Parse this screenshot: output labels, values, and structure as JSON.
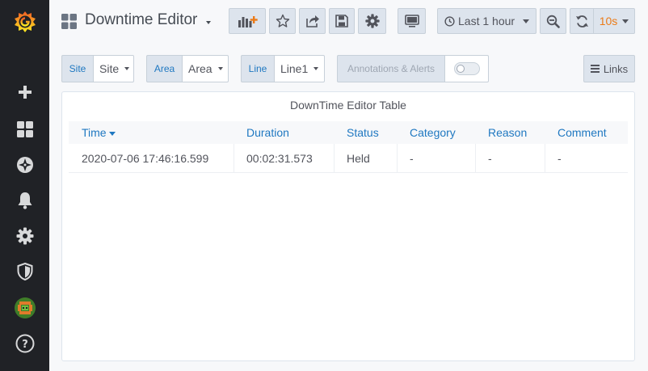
{
  "sidebar": {
    "items": [
      {
        "name": "grafana-logo-icon"
      },
      {
        "name": "plus-icon"
      },
      {
        "name": "dashboards-icon"
      },
      {
        "name": "explore-compass-icon"
      },
      {
        "name": "bell-alerting-icon"
      },
      {
        "name": "gear-configuration-icon"
      },
      {
        "name": "shield-admin-icon"
      },
      {
        "name": "user-avatar"
      },
      {
        "name": "help-icon"
      }
    ]
  },
  "header": {
    "title": "Downtime Editor",
    "time_range": "Last 1 hour",
    "refresh_interval": "10s",
    "accent_color": "#eb7b18"
  },
  "variables": [
    {
      "label": "Site",
      "value": "Site"
    },
    {
      "label": "Area",
      "value": "Area"
    },
    {
      "label": "Line",
      "value": "Line1"
    }
  ],
  "annotations": {
    "label": "Annotations & Alerts",
    "enabled": false
  },
  "links_label": "Links",
  "panel": {
    "title": "DownTime Editor Table",
    "columns": [
      "Time",
      "Duration",
      "Status",
      "Category",
      "Reason",
      "Comment"
    ],
    "rows": [
      [
        "2020-07-06 17:46:16.599",
        "00:02:31.573",
        "Held",
        "-",
        "-",
        "-"
      ]
    ]
  }
}
